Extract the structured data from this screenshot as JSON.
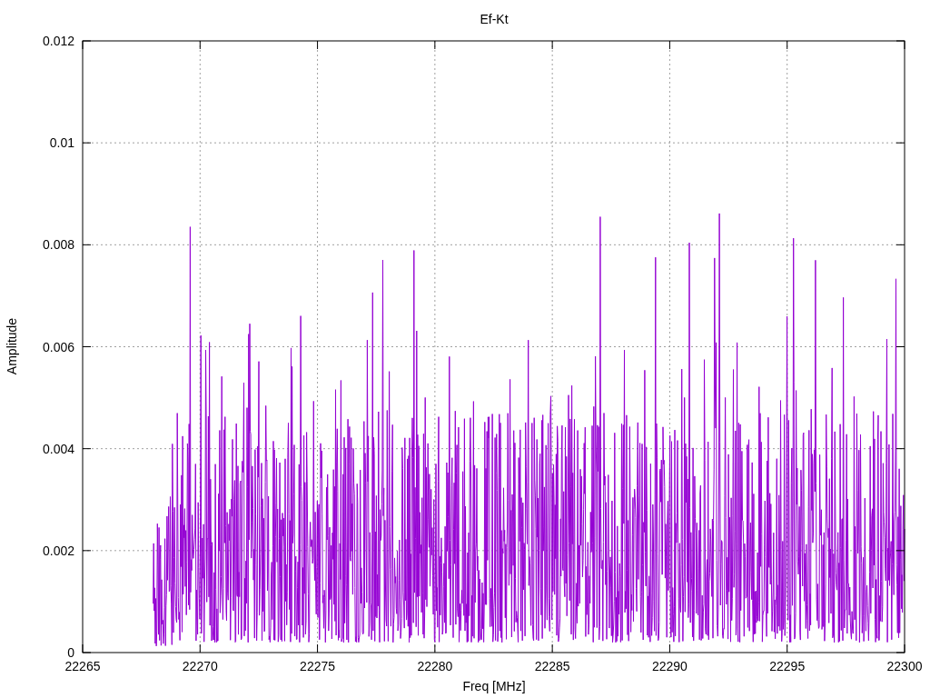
{
  "plot": {
    "title": "Ef-Kt",
    "xlabel": "Freq [MHz]",
    "ylabel": "Amplitude",
    "xticks": [
      "22265",
      "22270",
      "22275",
      "22280",
      "22285",
      "22290",
      "22295",
      "22300"
    ],
    "yticks": [
      "0.012",
      "0.01",
      "0.008",
      "0.006",
      "0.004",
      "0.002",
      "0"
    ]
  }
}
